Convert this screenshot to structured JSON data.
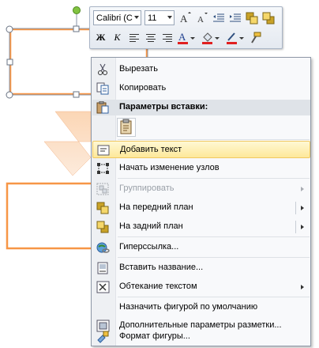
{
  "toolbar": {
    "font_name": "Calibri (C",
    "font_size": "11",
    "bold": "Ж",
    "italic": "К"
  },
  "menu": {
    "items": [
      {
        "label": "Вырезать",
        "icon": "scissors-icon"
      },
      {
        "label": "Копировать",
        "icon": "copy-icon"
      },
      {
        "label": "Параметры вставки:",
        "icon": "paste-icon"
      },
      {
        "label": "Добавить текст",
        "icon": "text-box-icon"
      },
      {
        "label": "Начать изменение узлов",
        "icon": "edit-points-icon"
      },
      {
        "label": "Группировать",
        "icon": "group-icon"
      },
      {
        "label": "На передний план",
        "icon": "bring-forward-icon"
      },
      {
        "label": "На задний план",
        "icon": "send-backward-icon"
      },
      {
        "label": "Гиперссылка...",
        "icon": "hyperlink-icon"
      },
      {
        "label": "Вставить название...",
        "icon": "caption-icon"
      },
      {
        "label": "Обтекание текстом",
        "icon": "wrap-text-icon"
      },
      {
        "label": "Назначить фигурой по умолчанию",
        "icon": ""
      },
      {
        "label": "Дополнительные параметры разметки...",
        "icon": "layout-icon"
      },
      {
        "label": "Формат фигуры...",
        "icon": "format-shape-icon"
      }
    ]
  },
  "colors": {
    "shape_border": "#f79646",
    "arrow_fill": "#fcd5b4",
    "annotation_arrow": "#e0262b",
    "highlight": "#fde89a"
  }
}
